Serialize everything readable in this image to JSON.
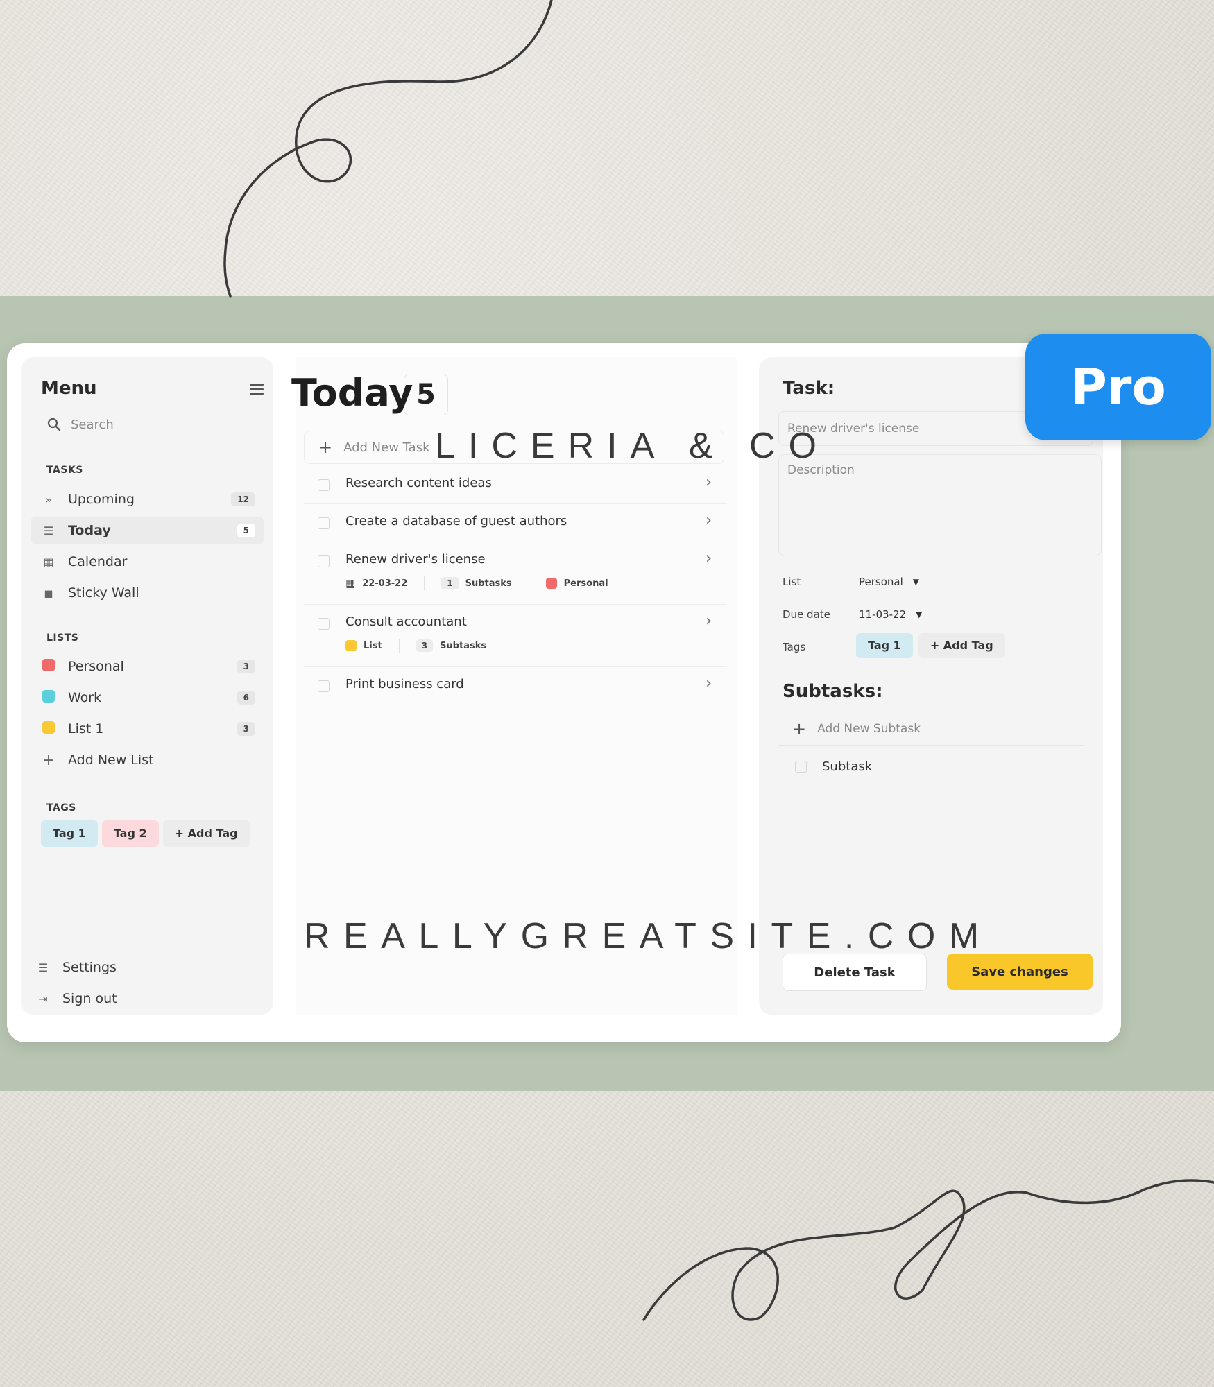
{
  "brand": "LICERIA & CO",
  "website": "REALLYGREATSITE.COM",
  "badge": "Pro",
  "colors": {
    "band": "#b8c5b2",
    "pro_badge": "#1d8ef0",
    "save_button": "#f9c72a",
    "tag1": "#d2eaf1",
    "tag2": "#fbd9dc",
    "personal": "#f06a6a",
    "work": "#5bd0dc",
    "list1": "#f8c933"
  },
  "sidebar": {
    "title": "Menu",
    "search_placeholder": "Search",
    "tasks_label": "TASKS",
    "tasks": [
      {
        "icon": "double-chevron-icon",
        "label": "Upcoming",
        "count": "12"
      },
      {
        "icon": "checklist-icon",
        "label": "Today",
        "count": "5",
        "active": true
      },
      {
        "icon": "calendar-icon",
        "label": "Calendar"
      },
      {
        "icon": "sticky-note-icon",
        "label": "Sticky Wall"
      }
    ],
    "lists_label": "LISTS",
    "lists": [
      {
        "label": "Personal",
        "count": "3",
        "color": "#f06a6a"
      },
      {
        "label": "Work",
        "count": "6",
        "color": "#5bd0dc"
      },
      {
        "label": "List 1",
        "count": "3",
        "color": "#f8c933"
      }
    ],
    "add_list": "Add New List",
    "tags_label": "TAGS",
    "tags": [
      "Tag 1",
      "Tag 2",
      "+ Add Tag"
    ],
    "settings": "Settings",
    "signout": "Sign out"
  },
  "main": {
    "title": "Today",
    "count": "5",
    "add_task": "Add New Task",
    "tasks": [
      {
        "label": "Research content ideas"
      },
      {
        "label": "Create a database of guest authors"
      },
      {
        "label": "Renew driver's license",
        "date": "22-03-22",
        "subtasks_count": "1",
        "subtasks_label": "Subtasks",
        "list": "Personal"
      },
      {
        "label": "Consult accountant",
        "list": "List",
        "subtasks_count": "3",
        "subtasks_label": "Subtasks"
      },
      {
        "label": "Print business card"
      }
    ]
  },
  "details": {
    "title": "Task:",
    "task_name": "Renew driver's license",
    "description_placeholder": "Description",
    "list_label": "List",
    "list_value": "Personal",
    "due_label": "Due date",
    "due_value": "11-03-22",
    "tags_label": "Tags",
    "tags": [
      "Tag 1",
      "+ Add Tag"
    ],
    "subtasks_title": "Subtasks:",
    "add_subtask": "Add New Subtask",
    "subtasks": [
      "Subtask"
    ],
    "delete_button": "Delete Task",
    "save_button": "Save changes"
  }
}
